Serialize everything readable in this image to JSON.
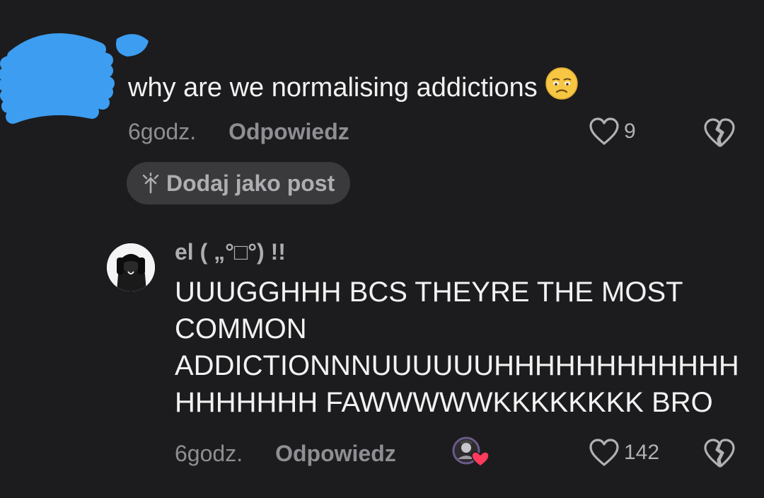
{
  "comment": {
    "author_name": "",
    "text": "why are we normalising addictions",
    "emoji": "worried-face-emoji",
    "time": "6godz.",
    "reply_label": "Odpowiedz",
    "like_count": "9",
    "add_post_label": "Dodaj jako post"
  },
  "reply": {
    "author_name": "el ( „°□°) !!",
    "text": "UUUGGHHH BCS THEYRE THE MOST\nCOMMON\nADDICTIONNNUUUUUUHHHHHHHHHHHH\nHHHHHHH FAWWWWWKKKKKKKK BRO",
    "time": "6godz.",
    "reply_label": "Odpowiedz",
    "like_count": "142"
  },
  "icons": {
    "like": "heart-outline-icon",
    "dislike": "broken-heart-outline-icon",
    "add_post": "sparkle-arrow-icon"
  },
  "colors": {
    "background": "#1c1c1e",
    "text_primary": "#f2f2f2",
    "text_secondary": "#8e8e93",
    "chip_background": "#3a3a3c",
    "redaction_blue": "#3d9df0",
    "creator_liked_heart": "#ff3b5c"
  }
}
